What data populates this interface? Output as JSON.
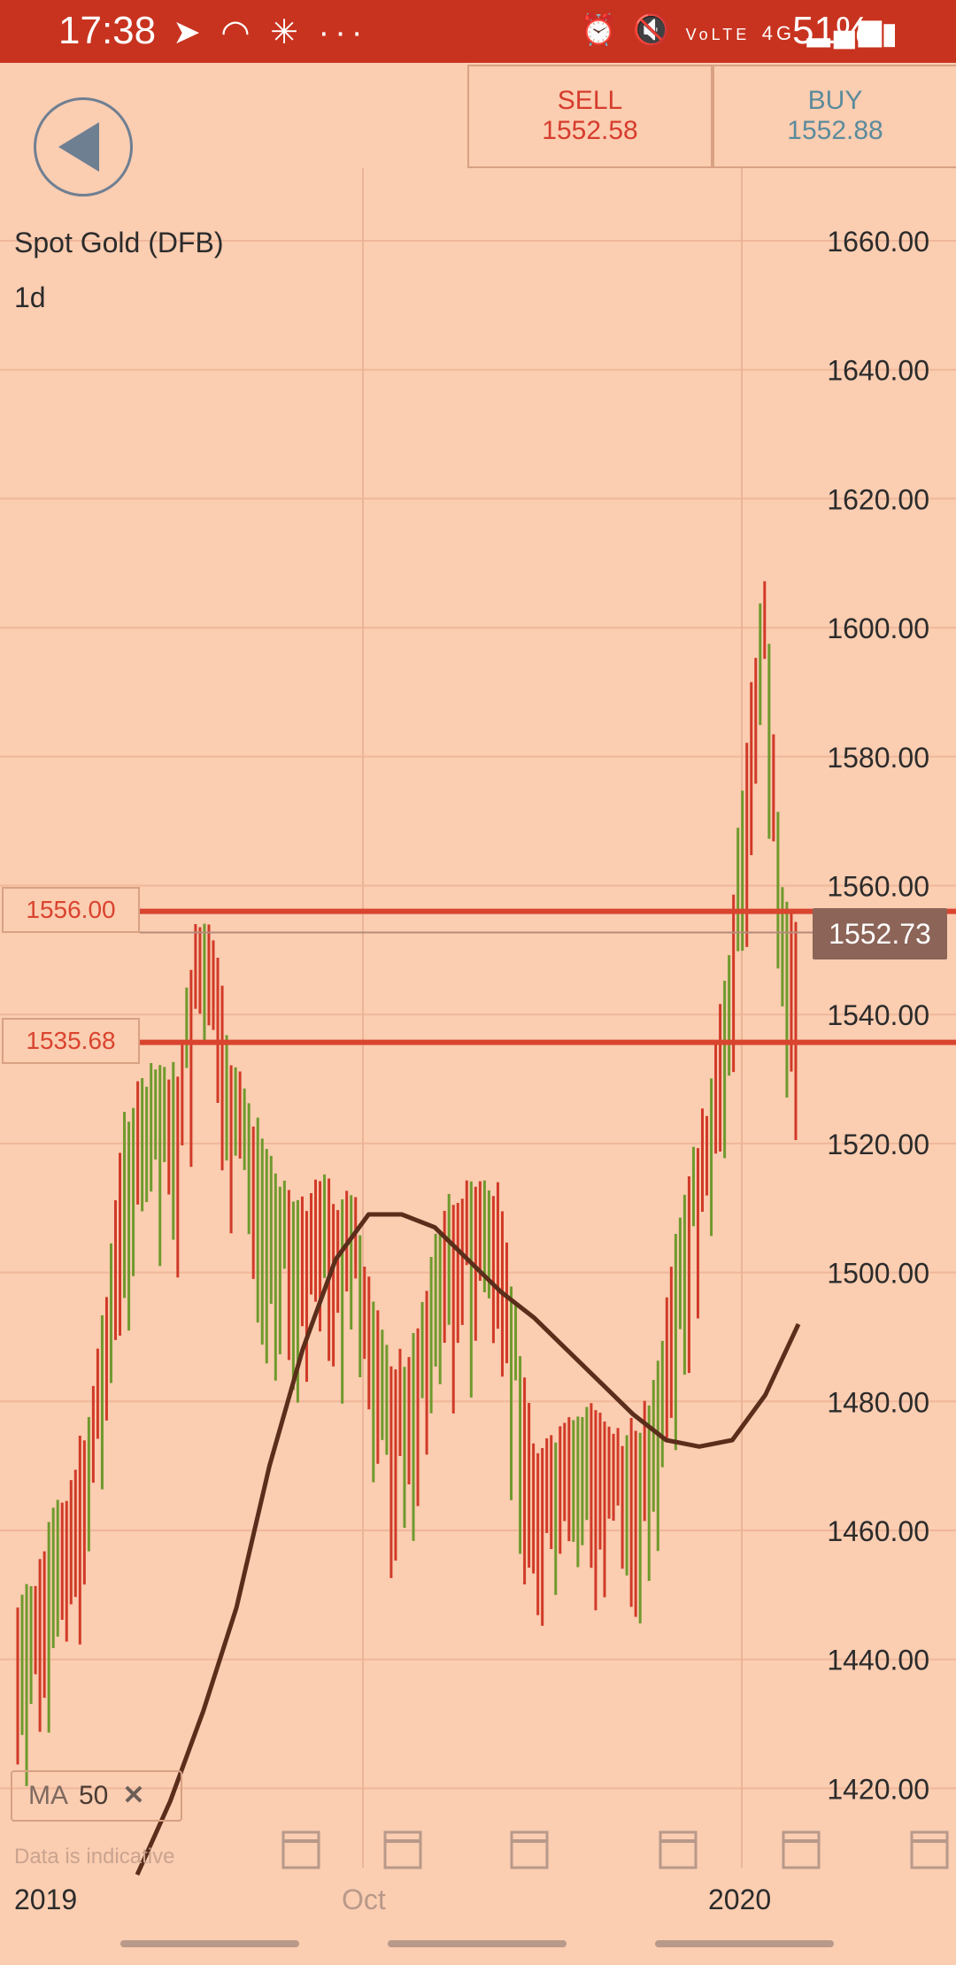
{
  "status_bar": {
    "time": "17:38",
    "battery_percent": "51%",
    "network": "4G",
    "icons_left": [
      "telegram-icon",
      "cloud-icon",
      "podcast-icon",
      "more-dots-icon"
    ],
    "icons_right": [
      "alarm-icon",
      "mute-icon",
      "volte-icon",
      "network-4g-icon",
      "signal-icon",
      "battery-icon"
    ]
  },
  "header": {
    "sell_label": "SELL",
    "sell_price": "1552.58",
    "buy_label": "BUY",
    "buy_price": "1552.88"
  },
  "instrument": {
    "name": "Spot Gold (DFB)",
    "period": "1d"
  },
  "levels": [
    {
      "label": "1556.00",
      "value": 1556.0,
      "color": "#d9442f"
    },
    {
      "label": "1535.68",
      "value": 1535.68,
      "color": "#d9442f"
    }
  ],
  "current_price": "1552.73",
  "indicator": {
    "label": "MA",
    "period": "50",
    "remove_icon": "close-icon"
  },
  "disclaimer": "Data is indicative",
  "x_labels": [
    "2019",
    "Oct",
    "2020"
  ],
  "colors": {
    "up": "#6f9a2d",
    "down": "#d13a28",
    "ma": "#5a2e1b",
    "level": "#d9442f",
    "background": "#fbcdb1"
  },
  "chart_data": {
    "type": "ohlc",
    "y_ticks": [
      "1660.00",
      "1640.00",
      "1620.00",
      "1600.00",
      "1580.00",
      "1560.00",
      "1540.00",
      "1520.00",
      "1500.00",
      "1480.00",
      "1460.00",
      "1440.00",
      "1420.00"
    ],
    "ylim": [
      1405,
      1665
    ],
    "x_ticks": [
      "2019",
      "Oct",
      "2020"
    ],
    "series": [
      {
        "name": "Price",
        "ohlc_highs": [
          1450,
          1454,
          1464,
          1470,
          1480,
          1500,
          1526,
          1531,
          1534,
          1533,
          1556,
          1554,
          1535,
          1528,
          1521,
          1516,
          1512,
          1518,
          1513,
          1513,
          1496,
          1489,
          1488,
          1501,
          1512,
          1515,
          1516,
          1514,
          1496,
          1476,
          1475,
          1478,
          1481,
          1480,
          1476,
          1479,
          1487,
          1506,
          1520,
          1531,
          1553,
          1586,
          1611,
          1562,
          1556
        ]
      },
      {
        "name": "MA 50",
        "values": [
          1405,
          1418,
          1432,
          1448,
          1470,
          1488,
          1502,
          1509,
          1509,
          1507,
          1502,
          1497,
          1493,
          1488,
          1483,
          1478,
          1474,
          1473,
          1474,
          1481,
          1492
        ]
      }
    ]
  }
}
